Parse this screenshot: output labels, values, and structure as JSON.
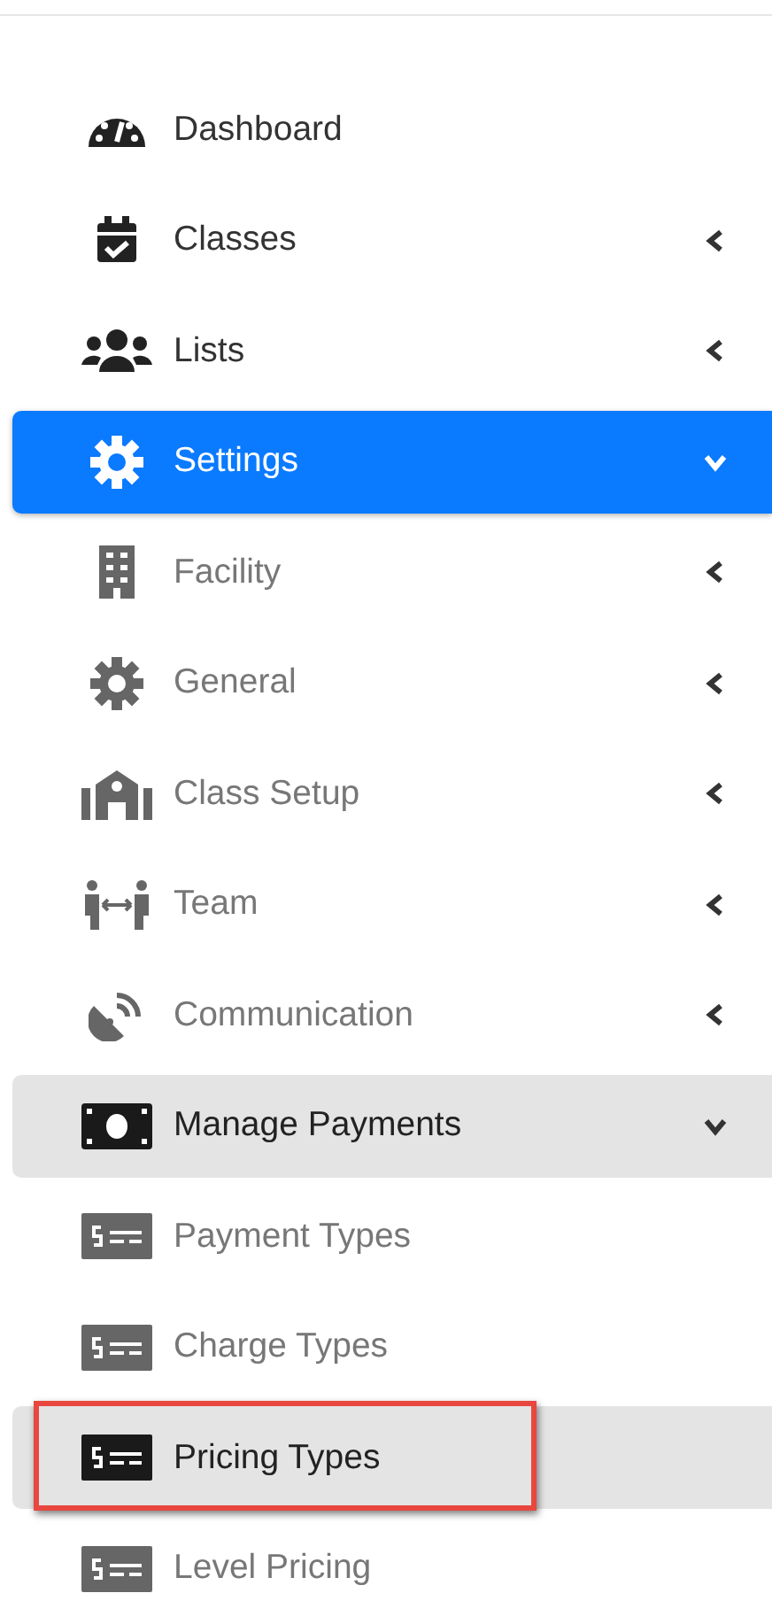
{
  "menu": [
    {
      "label": "Dashboard",
      "selected": false
    },
    {
      "label": "Classes",
      "selected": false,
      "expanded": false
    },
    {
      "label": "Lists",
      "selected": false,
      "expanded": false
    },
    {
      "label": "Settings",
      "selected": true,
      "expanded": true,
      "children": [
        {
          "label": "Facility",
          "selected": false,
          "expanded": false
        },
        {
          "label": "General",
          "selected": false,
          "expanded": false
        },
        {
          "label": "Class Setup",
          "selected": false,
          "expanded": false
        },
        {
          "label": "Team",
          "selected": false,
          "expanded": false
        },
        {
          "label": "Communication",
          "selected": false,
          "expanded": false
        },
        {
          "label": "Manage Payments",
          "selected": true,
          "expanded": true,
          "children": [
            {
              "label": "Payment Types",
              "selected": false
            },
            {
              "label": "Charge Types",
              "selected": false
            },
            {
              "label": "Pricing Types",
              "selected": true,
              "highlighted": true
            },
            {
              "label": "Level Pricing",
              "selected": false
            }
          ]
        }
      ]
    }
  ]
}
